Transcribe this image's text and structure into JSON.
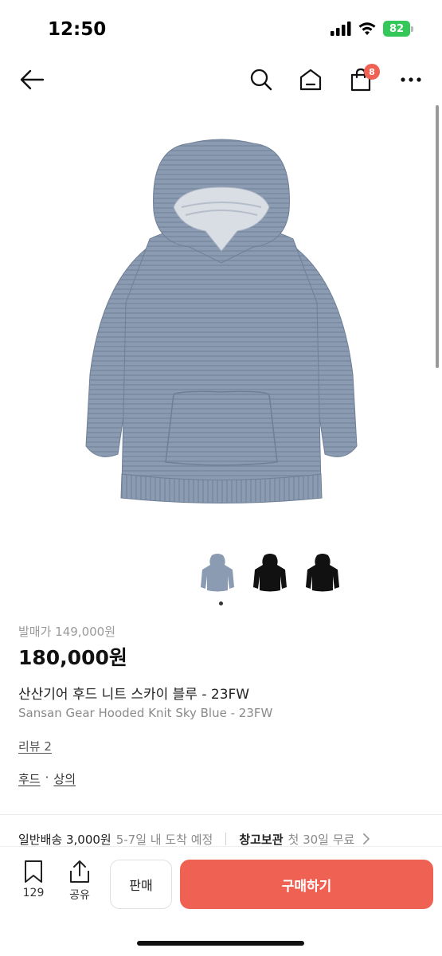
{
  "status_bar": {
    "time": "12:50",
    "battery": "82"
  },
  "header": {
    "icons": [
      "back-arrow-icon",
      "search-icon",
      "home-icon",
      "shopping-bag-icon",
      "more-icon"
    ],
    "cart_count": "8"
  },
  "product": {
    "image": "sky-blue-knit-hoodie",
    "thumbnail_colors": [
      "#8b9bb1",
      "#111111",
      "#111111"
    ],
    "retail_price_label": "발매가 149,000원",
    "price": "180,000원",
    "name_ko": "산산기어 후드 니트 스카이 블루 - 23FW",
    "name_en": "Sansan Gear Hooded Knit Sky Blue - 23FW",
    "reviews": "리뷰 2",
    "categories": [
      "후드",
      "상의"
    ],
    "category_separator": "·"
  },
  "shipping": {
    "general_label": "일반배송 3,000원",
    "general_eta": "5-7일 내 도착 예정",
    "storage_label": "창고보관",
    "storage_note": "첫 30일 무료"
  },
  "bottom_bar": {
    "bookmark_count": "129",
    "share_label": "공유",
    "sell_label": "판매",
    "buy_label": "구매하기"
  },
  "colors": {
    "accent": "#ef6253",
    "hoodie": "#8b9bb1"
  }
}
